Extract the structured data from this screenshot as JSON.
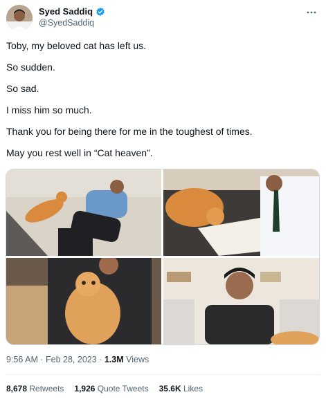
{
  "author": {
    "name": "Syed Saddiq",
    "handle": "@SyedSaddiq",
    "verified": true
  },
  "more_icon": "more-horizontal-icon",
  "tweet_lines": [
    "Toby, my beloved cat has left us.",
    "So sudden.",
    "So sad.",
    "I miss him so much.",
    "Thank you for being there for me in the toughest of times.",
    "May you rest well in “Cat heaven”."
  ],
  "media": [
    {
      "subject": "man lying on floor next to orange cat"
    },
    {
      "subject": "orange cat beside man signing documents"
    },
    {
      "subject": "man holding orange cat"
    },
    {
      "subject": "man with orange cat at table"
    }
  ],
  "meta": {
    "time": "9:56 AM",
    "date": "Feb 28, 2023",
    "separator": "·",
    "views_count": "1.3M",
    "views_label": "Views"
  },
  "stats": {
    "retweets_count": "8,678",
    "retweets_label": "Retweets",
    "quotes_count": "1,926",
    "quotes_label": "Quote Tweets",
    "likes_count": "35.6K",
    "likes_label": "Likes"
  },
  "colors": {
    "verified_blue": "#1d9bf0",
    "secondary_text": "#536471",
    "primary_text": "#0f1419"
  }
}
